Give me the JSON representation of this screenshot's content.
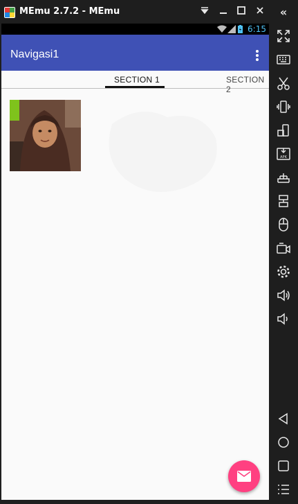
{
  "window": {
    "title": "MEmu 2.7.2 - MEmu",
    "controls": [
      "dropdown-icon",
      "minimize-icon",
      "maximize-icon",
      "close-icon"
    ],
    "collapse_glyph": "«"
  },
  "status_bar": {
    "time": "6:15",
    "icons": [
      "wifi-icon",
      "signal-icon",
      "battery-icon"
    ]
  },
  "app_bar": {
    "title": "Navigasi1",
    "menu_icon": "overflow-menu-icon",
    "color": "#3f51b5"
  },
  "tabs": [
    {
      "label": "SECTION 1",
      "selected": true
    },
    {
      "label": "SECTION 2",
      "selected": false
    }
  ],
  "content": {
    "image": "profile-photo"
  },
  "fab": {
    "icon": "mail-icon",
    "color": "#ff4081"
  },
  "emulator_toolbar": [
    "fullscreen-icon",
    "keyboard-icon",
    "scissors-icon",
    "shake-icon",
    "rotate-icon",
    "apk-install-icon",
    "network-icon",
    "transfer-icon",
    "mouse-icon",
    "video-record-icon",
    "settings-icon",
    "volume-up-icon",
    "volume-down-icon",
    "back-icon",
    "home-icon",
    "recent-apps-icon",
    "menu-list-icon"
  ],
  "colors": {
    "chrome": "#1e1e1e",
    "accent": "#4fc3f7"
  }
}
